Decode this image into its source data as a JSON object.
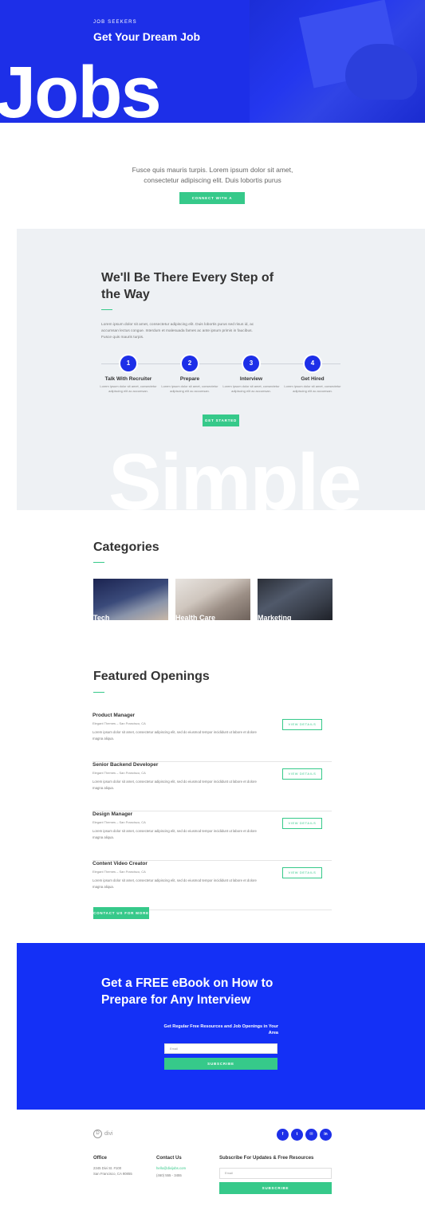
{
  "hero": {
    "eyebrow": "JOB SEEKERS",
    "title": "Get Your Dream Job",
    "big_word": "Jobs"
  },
  "intro": {
    "text": "Fusce quis mauris turpis. Lorem ipsum dolor sit amet, consectetur adipiscing elit. Duis lobortis purus",
    "button": "CONNECT WITH A RECRUITER"
  },
  "steps": {
    "heading": "We'll Be There Every Step of the Way",
    "paragraph": "Lorem ipsum dolor sit amet, consectetur adipiscing elit. Duis lobortis purus sed risus id, ac accumsan lectus congue. Interdum et malesuada fames ac ante ipsum primis in faucibus. Fusce quis mauris turpis.",
    "items": [
      {
        "num": "1",
        "title": "Talk With Recruiter",
        "desc": "Lorem ipsum dolor sit amet, consectetur adipiscing elit ac accumsan."
      },
      {
        "num": "2",
        "title": "Prepare",
        "desc": "Lorem ipsum dolor sit amet, consectetur adipiscing elit ac accumsan."
      },
      {
        "num": "3",
        "title": "Interview",
        "desc": "Lorem ipsum dolor sit amet, consectetur adipiscing elit ac accumsan."
      },
      {
        "num": "4",
        "title": "Get Hired",
        "desc": "Lorem ipsum dolor sit amet, consectetur adipiscing elit ac accumsan."
      }
    ],
    "button": "GET STARTED",
    "big_word": "Simple"
  },
  "categories": {
    "heading": "Categories",
    "items": [
      {
        "label": "Tech"
      },
      {
        "label": "Health Care"
      },
      {
        "label": "Marketing"
      }
    ]
  },
  "openings": {
    "heading": "Featured Openings",
    "view_label": "VIEW DETAILS",
    "jobs": [
      {
        "title": "Product Manager",
        "company": "Elegant Themes – San Francisco, CA",
        "desc": "Lorem ipsum dolor sit amet, consectetur adipiscing elit, sed do eiusmod tempor incididunt ut labore et dolore magna aliqua."
      },
      {
        "title": "Senior Backend Developer",
        "company": "Elegant Themes – San Francisco, CA",
        "desc": "Lorem ipsum dolor sit amet, consectetur adipiscing elit, sed do eiusmod tempor incididunt ut labore et dolore magna aliqua."
      },
      {
        "title": "Design Manager",
        "company": "Elegant Themes – San Francisco, CA",
        "desc": "Lorem ipsum dolor sit amet, consectetur adipiscing elit, sed do eiusmod tempor incididunt ut labore et dolore magna aliqua."
      },
      {
        "title": "Content Video Creator",
        "company": "Elegant Themes – San Francisco, CA",
        "desc": "Lorem ipsum dolor sit amet, consectetur adipiscing elit, sed do eiusmod tempor incididunt ut labore et dolore magna aliqua."
      }
    ],
    "contact_button": "CONTACT US FOR MORE"
  },
  "ebook": {
    "heading": "Get a FREE eBook on How to Prepare for Any Interview",
    "sub": "Get Regular Free Resources and Job Openings in Your Area",
    "email_placeholder": "Email",
    "button": "SUBSCRIBE"
  },
  "footer": {
    "logo_letter": "D",
    "logo_text": "divi",
    "social": [
      "f",
      "t",
      "✉",
      "in"
    ],
    "office_heading": "Office",
    "office_line1": "2345 Divi St. #100",
    "office_line2": "San Francisco, CA 90855",
    "contact_heading": "Contact Us",
    "contact_email": "hello@divijobs.com",
    "contact_phone": "(460) 555 - 3455",
    "subscribe_heading": "Subscribe For Updates & Free Resources",
    "email_placeholder": "Email",
    "button": "SUBSCRIBE"
  },
  "colors": {
    "brand_blue": "#1d2fe8",
    "accent_green": "#36c98a"
  }
}
